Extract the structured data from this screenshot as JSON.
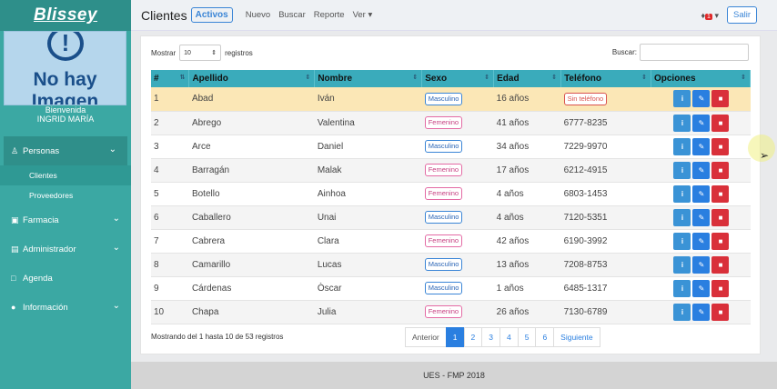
{
  "sidebar": {
    "brand": "Blissey",
    "avatar": {
      "bang": "!",
      "line1": "No hay",
      "line2": "Imagen"
    },
    "welcome": "Bienvenida",
    "user": "INGRID MARÍA",
    "menu": [
      {
        "label": "Personas",
        "icon": "users-icon",
        "chev": "❯"
      },
      {
        "label": "Clientes"
      },
      {
        "label": "Proveedores"
      },
      {
        "label": "Farmacia",
        "icon": "medkit-icon"
      },
      {
        "label": "Administrador",
        "icon": "lock-icon"
      },
      {
        "label": "Agenda",
        "icon": "calendar-icon"
      },
      {
        "label": "Información",
        "icon": "info-icon"
      }
    ]
  },
  "topbar": {
    "title": "Clientes",
    "status": "Activos",
    "nav": [
      "Nuevo",
      "Buscar",
      "Reporte",
      "Ver"
    ],
    "notifications": "1",
    "logout": "Salir"
  },
  "controls": {
    "show_label": "Mostrar",
    "show_value": "10",
    "records_label": "registros",
    "search_label": "Buscar:"
  },
  "table": {
    "headers": [
      "#",
      "Apellido",
      "Nombre",
      "Sexo",
      "Edad",
      "Teléfono",
      "Opciones"
    ],
    "rows": [
      [
        "1",
        "Abad",
        "Iván",
        "Masculino",
        "16 años",
        "Sin teléfono"
      ],
      [
        "2",
        "Abrego",
        "Valentina",
        "Femenino",
        "41 años",
        "6777-8235"
      ],
      [
        "3",
        "Arce",
        "Daniel",
        "Masculino",
        "34 años",
        "7229-9970"
      ],
      [
        "4",
        "Barragán",
        "Malak",
        "Femenino",
        "17 años",
        "6212-4915"
      ],
      [
        "5",
        "Botello",
        "Ainhoa",
        "Femenino",
        "4 años",
        "6803-1453"
      ],
      [
        "6",
        "Caballero",
        "Unai",
        "Masculino",
        "4 años",
        "7120-5351"
      ],
      [
        "7",
        "Cabrera",
        "Clara",
        "Femenino",
        "42 años",
        "6190-3992"
      ],
      [
        "8",
        "Camarillo",
        "Lucas",
        "Masculino",
        "13 años",
        "7208-8753"
      ],
      [
        "9",
        "Cárdenas",
        "Òscar",
        "Masculino",
        "1 años",
        "6485-1317"
      ],
      [
        "10",
        "Chapa",
        "Julia",
        "Femenino",
        "26 años",
        "7130-6789"
      ]
    ]
  },
  "summary": "Mostrando del 1 hasta 10 de 53 registros",
  "pager": {
    "prev": "Anterior",
    "pages": [
      "1",
      "2",
      "3",
      "4",
      "5",
      "6"
    ],
    "next": "Siguiente"
  },
  "footer": "UES - FMP 2018",
  "colors": {
    "sidebar": "#3ba8a3",
    "header": "#3aabbb",
    "highlight": "#fbe7b6",
    "primary": "#2a7fe0",
    "danger": "#d9303a"
  }
}
